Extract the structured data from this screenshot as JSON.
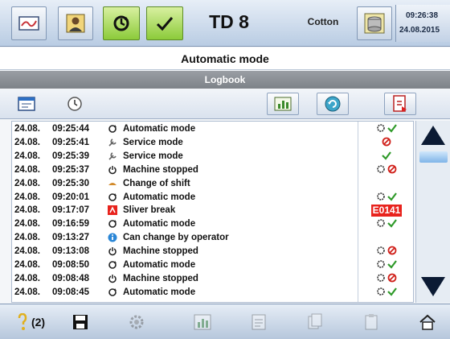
{
  "topbar": {
    "title": "TD 8",
    "material": "Cotton",
    "time": "09:26:38",
    "date": "24.08.2015"
  },
  "mode_header": "Automatic mode",
  "section_title": "Logbook",
  "log": {
    "rows": [
      {
        "date": "24.08.",
        "time": "09:25:44",
        "icon": "auto-mode-icon",
        "text": "Automatic mode",
        "status": [
          "gear-icon",
          "check-icon"
        ],
        "code": ""
      },
      {
        "date": "24.08.",
        "time": "09:25:41",
        "icon": "service-icon",
        "text": "Service mode",
        "status": [
          "stop-icon"
        ],
        "code": ""
      },
      {
        "date": "24.08.",
        "time": "09:25:39",
        "icon": "service-icon",
        "text": "Service mode",
        "status": [
          "check-icon"
        ],
        "code": ""
      },
      {
        "date": "24.08.",
        "time": "09:25:37",
        "icon": "power-icon",
        "text": "Machine stopped",
        "status": [
          "gear-icon",
          "stop-icon"
        ],
        "code": ""
      },
      {
        "date": "24.08.",
        "time": "09:25:30",
        "icon": "shift-icon",
        "text": "Change of shift",
        "status": [],
        "code": ""
      },
      {
        "date": "24.08.",
        "time": "09:20:01",
        "icon": "auto-mode-icon",
        "text": "Automatic mode",
        "status": [
          "gear-icon",
          "check-icon"
        ],
        "code": ""
      },
      {
        "date": "24.08.",
        "time": "09:17:07",
        "icon": "sliver-icon",
        "text": "Sliver break",
        "status": [],
        "code": "E0141"
      },
      {
        "date": "24.08.",
        "time": "09:16:59",
        "icon": "auto-mode-icon",
        "text": "Automatic mode",
        "status": [
          "gear-icon",
          "check-icon"
        ],
        "code": ""
      },
      {
        "date": "24.08.",
        "time": "09:13:27",
        "icon": "info-icon",
        "text": "Can change by operator",
        "status": [],
        "code": ""
      },
      {
        "date": "24.08.",
        "time": "09:13:08",
        "icon": "power-icon",
        "text": "Machine stopped",
        "status": [
          "gear-icon",
          "stop-icon"
        ],
        "code": ""
      },
      {
        "date": "24.08.",
        "time": "09:08:50",
        "icon": "auto-mode-icon",
        "text": "Automatic mode",
        "status": [
          "gear-icon",
          "check-icon"
        ],
        "code": ""
      },
      {
        "date": "24.08.",
        "time": "09:08:48",
        "icon": "power-icon",
        "text": "Machine stopped",
        "status": [
          "gear-icon",
          "stop-icon"
        ],
        "code": ""
      },
      {
        "date": "24.08.",
        "time": "09:08:45",
        "icon": "auto-mode-icon",
        "text": "Automatic mode",
        "status": [
          "gear-icon",
          "check-icon"
        ],
        "code": ""
      }
    ]
  },
  "bottombar": {
    "help_count": "(2)"
  },
  "colors": {
    "accent_green": "#6ab82a",
    "error_red": "#e8231d",
    "scroll_arrow": "#0b1a33"
  }
}
